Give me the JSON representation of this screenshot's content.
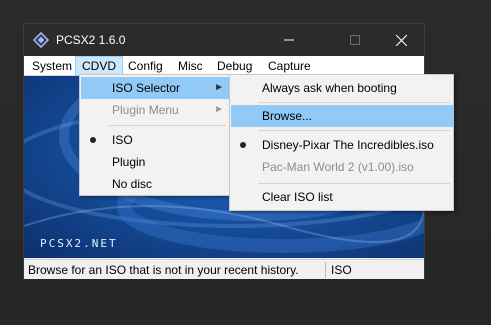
{
  "window": {
    "title": "PCSX2  1.6.0",
    "icons": {
      "app": "pcsx2-logo-icon",
      "minimize": "minimize-icon",
      "maximize": "maximize-icon",
      "close": "close-icon"
    }
  },
  "menubar": {
    "items": [
      {
        "label": "System"
      },
      {
        "label": "CDVD",
        "active": true
      },
      {
        "label": "Config"
      },
      {
        "label": "Misc"
      },
      {
        "label": "Debug"
      },
      {
        "label": "Capture"
      }
    ]
  },
  "content": {
    "brand": "PCSX2.NET"
  },
  "cdvd_menu": {
    "items": [
      {
        "label": "ISO Selector",
        "submenu": true,
        "highlighted": true
      },
      {
        "label": "Plugin Menu",
        "submenu": true,
        "disabled": true
      },
      {
        "label": "ISO",
        "checked": true
      },
      {
        "label": "Plugin"
      },
      {
        "label": "No disc"
      }
    ]
  },
  "iso_menu": {
    "items": [
      {
        "label": "Always ask when booting"
      },
      {
        "label": "Browse...",
        "highlighted": true
      },
      {
        "label": "Disney-Pixar The Incredibles.iso",
        "checked": true
      },
      {
        "label": "Pac-Man World 2 (v1.00).iso",
        "disabled": true
      },
      {
        "label": "Clear ISO list"
      }
    ]
  },
  "statusbar": {
    "message": "Browse for an ISO that is not in your recent history.",
    "mode": "ISO"
  },
  "colors": {
    "titlebar": "#2b2b2b",
    "menu_highlight": "#91c9f7",
    "menubar_active": "#cce8ff",
    "content_blue": "#164f9e"
  }
}
